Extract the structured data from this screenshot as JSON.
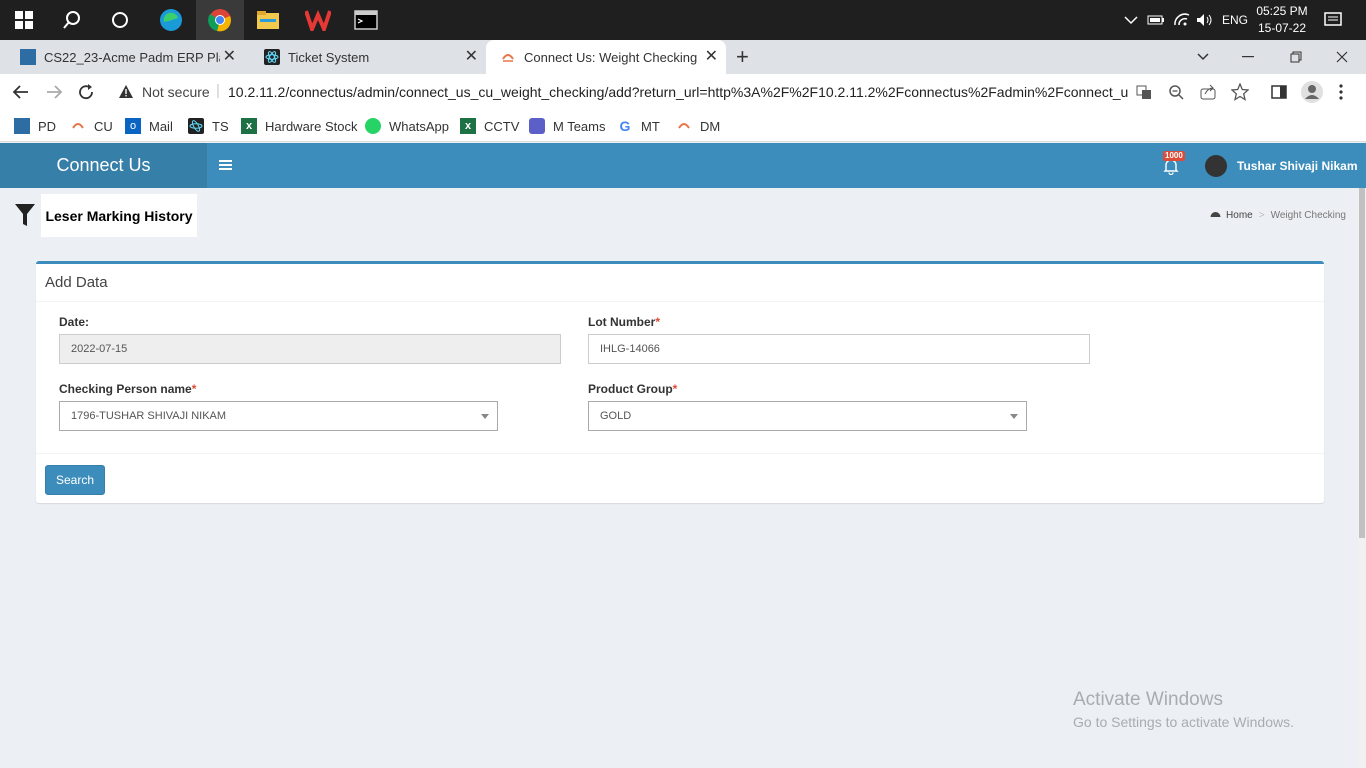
{
  "taskbar": {
    "lang": "ENG",
    "time": "05:25 PM",
    "date": "15-07-22"
  },
  "tabs": [
    {
      "title": "CS22_23-Acme Padm ERP Platfor"
    },
    {
      "title": "Ticket System"
    },
    {
      "title": "Connect Us: Weight Checking"
    }
  ],
  "address": {
    "security": "Not secure",
    "url": "10.2.11.2/connectus/admin/connect_us_cu_weight_checking/add?return_url=http%3A%2F%2F10.2.11.2%2Fconnectus%2Fadmin%2Fconnect_us_..."
  },
  "bookmarks": [
    {
      "label": "PD"
    },
    {
      "label": "CU"
    },
    {
      "label": "Mail"
    },
    {
      "label": "TS"
    },
    {
      "label": "Hardware Stock"
    },
    {
      "label": "WhatsApp"
    },
    {
      "label": "CCTV"
    },
    {
      "label": "M Teams"
    },
    {
      "label": "MT"
    },
    {
      "label": "DM"
    }
  ],
  "app": {
    "name": "Connect Us",
    "notif_count": "1000",
    "user_name": "Tushar Shivaji Nikam"
  },
  "page": {
    "title": "Leser Marking History",
    "breadcrumb_home": "Home",
    "breadcrumb_sep": ">",
    "breadcrumb_current": "Weight Checking"
  },
  "form": {
    "box_title": "Add Data",
    "date_label": "Date:",
    "date_value": "2022-07-15",
    "lot_label": "Lot Number",
    "lot_value": "IHLG-14066",
    "person_label": "Checking Person name",
    "person_value": "1796-TUSHAR SHIVAJI NIKAM",
    "group_label": "Product Group",
    "group_value": "GOLD",
    "required_mark": "*",
    "search_button": "Search"
  },
  "watermark": {
    "line1": "Activate Windows",
    "line2": "Go to Settings to activate Windows."
  },
  "colors": {
    "header": "#3c8dbc",
    "logo_bg": "#367fa9",
    "content_bg": "#ecf0f5",
    "required": "#dd4b39"
  }
}
